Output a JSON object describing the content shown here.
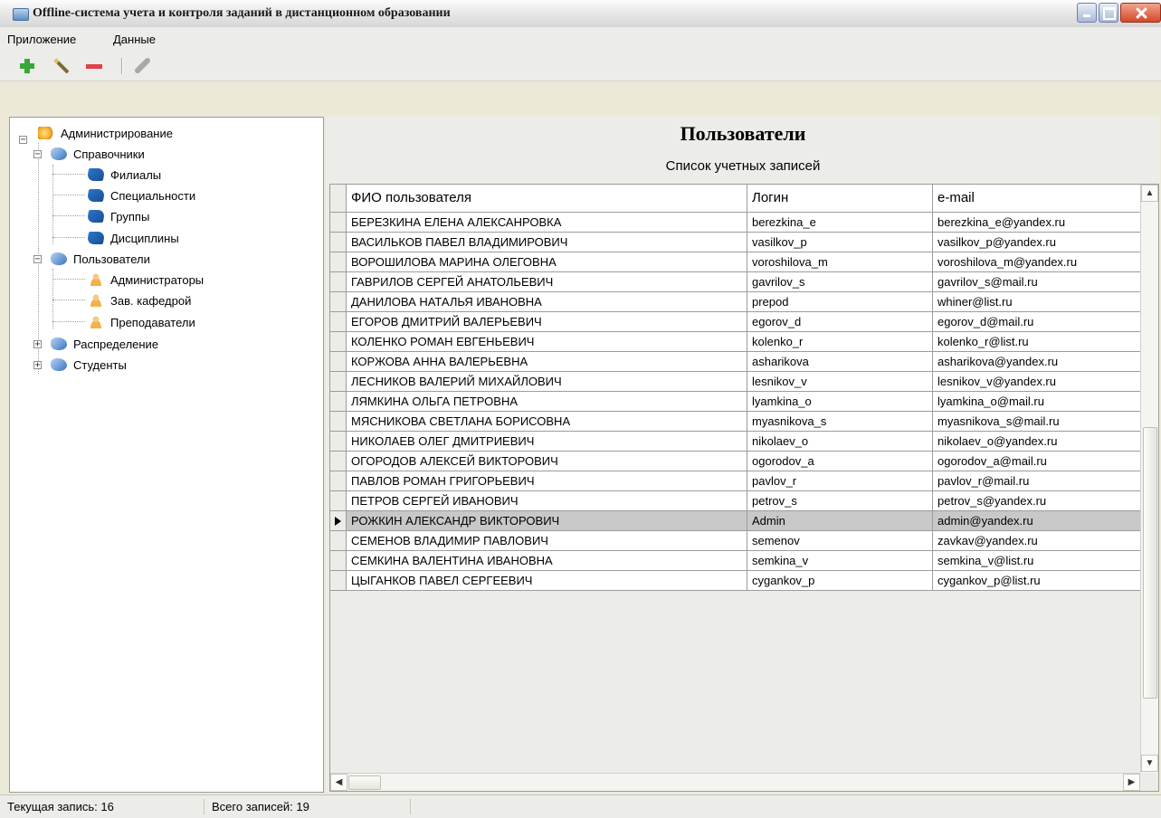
{
  "window": {
    "title": "Offline-система учета и контроля заданий в дистанционном образовании"
  },
  "menu": {
    "items": [
      "Приложение",
      "Данные"
    ]
  },
  "toolbar": {
    "buttons": [
      "add-icon",
      "edit-icon",
      "delete-icon",
      "eraser-icon"
    ]
  },
  "tree": {
    "root": "Администрирование",
    "references": "Справочники",
    "ref_items": [
      "Филиалы",
      "Специальности",
      "Группы",
      "Дисциплины"
    ],
    "users": "Пользователи",
    "user_items": [
      "Администраторы",
      "Зав. кафедрой",
      "Преподаватели"
    ],
    "distribution": "Распределение",
    "students": "Студенты",
    "expand_collapsed": "+",
    "expand_open": "−"
  },
  "main": {
    "title": "Пользователи",
    "subtitle": "Список учетных записей"
  },
  "grid": {
    "columns": [
      "ФИО пользователя",
      "Логин",
      "e-mail"
    ],
    "selected_index": 15,
    "rows": [
      [
        "БЕРЕЗКИНА ЕЛЕНА АЛЕКСАНРОВКА",
        "berezkina_e",
        "berezkina_e@yandex.ru"
      ],
      [
        "ВАСИЛЬКОВ ПАВЕЛ ВЛАДИМИРОВИЧ",
        "vasilkov_p",
        "vasilkov_p@yandex.ru"
      ],
      [
        "ВОРОШИЛОВА МАРИНА ОЛЕГОВНА",
        "voroshilova_m",
        "voroshilova_m@yandex.ru"
      ],
      [
        "ГАВРИЛОВ СЕРГЕЙ АНАТОЛЬЕВИЧ",
        "gavrilov_s",
        "gavrilov_s@mail.ru"
      ],
      [
        "ДАНИЛОВА НАТАЛЬЯ ИВАНОВНА",
        "prepod",
        "whiner@list.ru"
      ],
      [
        "ЕГОРОВ ДМИТРИЙ ВАЛЕРЬЕВИЧ",
        "egorov_d",
        "egorov_d@mail.ru"
      ],
      [
        "КОЛЕНКО РОМАН ЕВГЕНЬЕВИЧ",
        "kolenko_r",
        "kolenko_r@list.ru"
      ],
      [
        "КОРЖОВА АННА ВАЛЕРЬЕВНА",
        "asharikova",
        "asharikova@yandex.ru"
      ],
      [
        "ЛЕСНИКОВ ВАЛЕРИЙ МИХАЙЛОВИЧ",
        "lesnikov_v",
        "lesnikov_v@yandex.ru"
      ],
      [
        "ЛЯМКИНА ОЛЬГА ПЕТРОВНА",
        "lyamkina_o",
        "lyamkina_o@mail.ru"
      ],
      [
        "МЯСНИКОВА СВЕТЛАНА БОРИСОВНА",
        "myasnikova_s",
        "myasnikova_s@mail.ru"
      ],
      [
        "НИКОЛАЕВ ОЛЕГ ДМИТРИЕВИЧ",
        "nikolaev_o",
        "nikolaev_o@yandex.ru"
      ],
      [
        "ОГОРОДОВ АЛЕКСЕЙ ВИКТОРОВИЧ",
        "ogorodov_a",
        "ogorodov_a@mail.ru"
      ],
      [
        "ПАВЛОВ РОМАН ГРИГОРЬЕВИЧ",
        "pavlov_r",
        "pavlov_r@mail.ru"
      ],
      [
        "ПЕТРОВ СЕРГЕЙ ИВАНОВИЧ",
        "petrov_s",
        "petrov_s@yandex.ru"
      ],
      [
        "РОЖКИН АЛЕКСАНДР ВИКТОРОВИЧ",
        "Admin",
        "admin@yandex.ru"
      ],
      [
        "СЕМЕНОВ ВЛАДИМИР ПАВЛОВИЧ",
        "semenov",
        "zavkav@yandex.ru"
      ],
      [
        "СЕМКИНА ВАЛЕНТИНА ИВАНОВНА",
        "semkina_v",
        "semkina_v@list.ru"
      ],
      [
        "ЦЫГАНКОВ ПАВЕЛ СЕРГЕЕВИЧ",
        "cygankov_p",
        "cygankov_p@list.ru"
      ]
    ]
  },
  "scroll": {
    "up": "▲",
    "down": "▼",
    "left": "◀",
    "right": "▶"
  },
  "status": {
    "current": "Текущая запись: 16",
    "total": "Всего записей: 19"
  }
}
